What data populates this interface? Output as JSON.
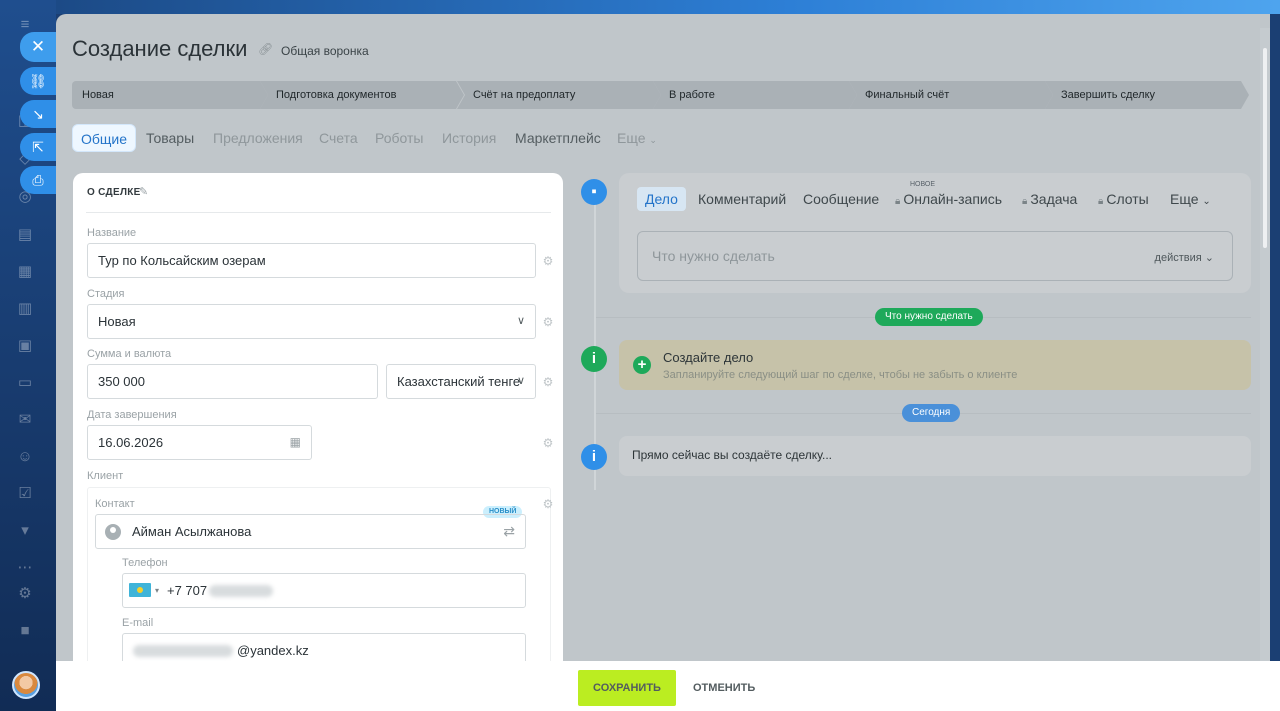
{
  "header": {
    "title": "Создание сделки",
    "funnel": "Общая воронка"
  },
  "stages": [
    "Новая",
    "Подготовка документов",
    "Счёт на предоплату",
    "В работе",
    "Финальный счёт",
    "Завершить сделку"
  ],
  "tabs": [
    "Общие",
    "Товары",
    "Предложения",
    "Счета",
    "Роботы",
    "История",
    "Маркетплейс",
    "Еще"
  ],
  "about": {
    "section_title": "О СДЕЛКЕ",
    "name_label": "Название",
    "name_value": "Тур по Кольсайским озерам",
    "stage_label": "Стадия",
    "stage_value": "Новая",
    "amount_label": "Сумма и валюта",
    "amount_value": "350 000",
    "currency_value": "Казахстанский тенге",
    "date_label": "Дата завершения",
    "date_value": "16.06.2026",
    "client_label": "Клиент",
    "contact_label": "Контакт",
    "contact_badge": "НОВЫЙ",
    "contact_name": "Айман Асылжанова",
    "phone_label": "Телефон",
    "phone_prefix": "+7 707",
    "email_label": "E-mail",
    "email_suffix": "@yandex.kz"
  },
  "composer": {
    "tabs": [
      "Дело",
      "Комментарий",
      "Сообщение",
      "Онлайн-запись",
      "Задача",
      "Слоты",
      "Еще"
    ],
    "new_tag": "НОВОЕ",
    "placeholder": "Что нужно сделать",
    "actions": "действия"
  },
  "timeline": {
    "todo_pill": "Что нужно сделать",
    "create_title": "Создайте дело",
    "create_sub": "Запланируйте следующий шаг по сделке, чтобы не забыть о клиенте",
    "today_pill": "Сегодня",
    "info_text": "Прямо сейчас вы создаёте сделку..."
  },
  "footer": {
    "save": "СОХРАНИТЬ",
    "cancel": "ОТМЕНИТЬ"
  },
  "colors": {
    "save_button": "#bbed21",
    "accent_blue": "#2f8fe8",
    "todo_pill": "#1ea95a",
    "today_pill": "#4a90d9"
  },
  "icons": [
    "close-icon",
    "link-icon",
    "download-icon",
    "share-icon",
    "print-icon",
    "chat-icon",
    "info-icon",
    "plus-icon",
    "gear-icon",
    "calendar-icon",
    "swap-icon",
    "chevron-down-icon",
    "lock-icon"
  ]
}
